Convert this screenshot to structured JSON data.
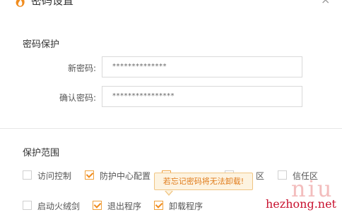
{
  "window": {
    "title": "密码设置",
    "close_label": "×"
  },
  "password_section": {
    "title": "密码保护",
    "fields": [
      {
        "label": "新密码:",
        "value": "**************"
      },
      {
        "label": "确认密码:",
        "value": "****************"
      }
    ]
  },
  "scope_section": {
    "title": "保护范围",
    "items": [
      {
        "label": "访问控制",
        "checked": false
      },
      {
        "label": "防护中心配置",
        "checked": true
      },
      {
        "label": "",
        "checked": true
      },
      {
        "label": "",
        "checked": false
      },
      {
        "label": "信任区",
        "checked": false
      },
      {
        "label": "启动火绒剑",
        "checked": false
      },
      {
        "label": "退出程序",
        "checked": true
      },
      {
        "label": "卸载程序",
        "checked": true
      }
    ],
    "tooltip": "若忘记密码将无法卸载!",
    "partial_labels": [
      "区"
    ]
  },
  "watermark": {
    "mark": "niu",
    "domain": "hezhong.net"
  },
  "colors": {
    "accent": "#f08c1e",
    "tooltip_bg": "#fdf3e0",
    "watermark": "#c8102e"
  }
}
